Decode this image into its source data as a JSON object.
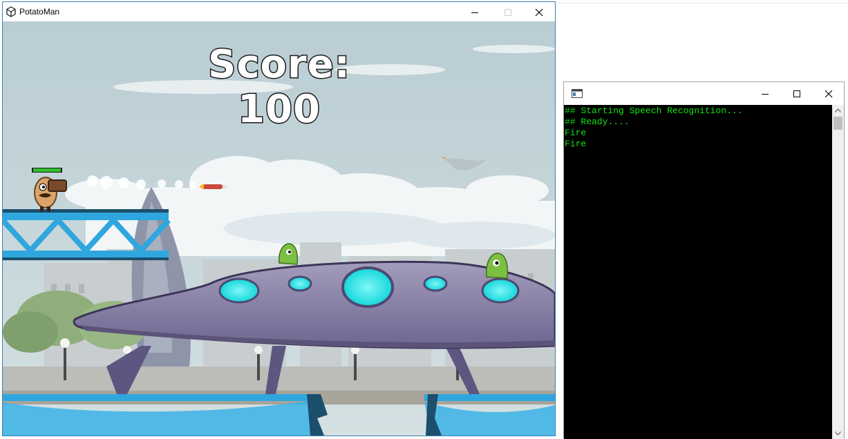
{
  "game": {
    "title": "PotatoMan",
    "score_text": "Score: 100",
    "player_health": 1.0
  },
  "console": {
    "title": "",
    "lines": [
      "## Starting Speech Recognition...",
      "## Ready....",
      "Fire",
      "Fire"
    ]
  },
  "icons": {
    "game_app": "unity-icon",
    "console_app": "console-icon",
    "minimize": "minimize-icon",
    "maximize": "maximize-icon",
    "close": "close-icon"
  },
  "colors": {
    "console_text": "#12e412",
    "console_bg": "#000000",
    "sky": "#c6d6da",
    "bridge": "#3bb3e6",
    "ufo_body": "#8a82a4",
    "ufo_window": "#2ee6e6",
    "alien": "#7bc043",
    "health_bar": "#2ec02e"
  }
}
